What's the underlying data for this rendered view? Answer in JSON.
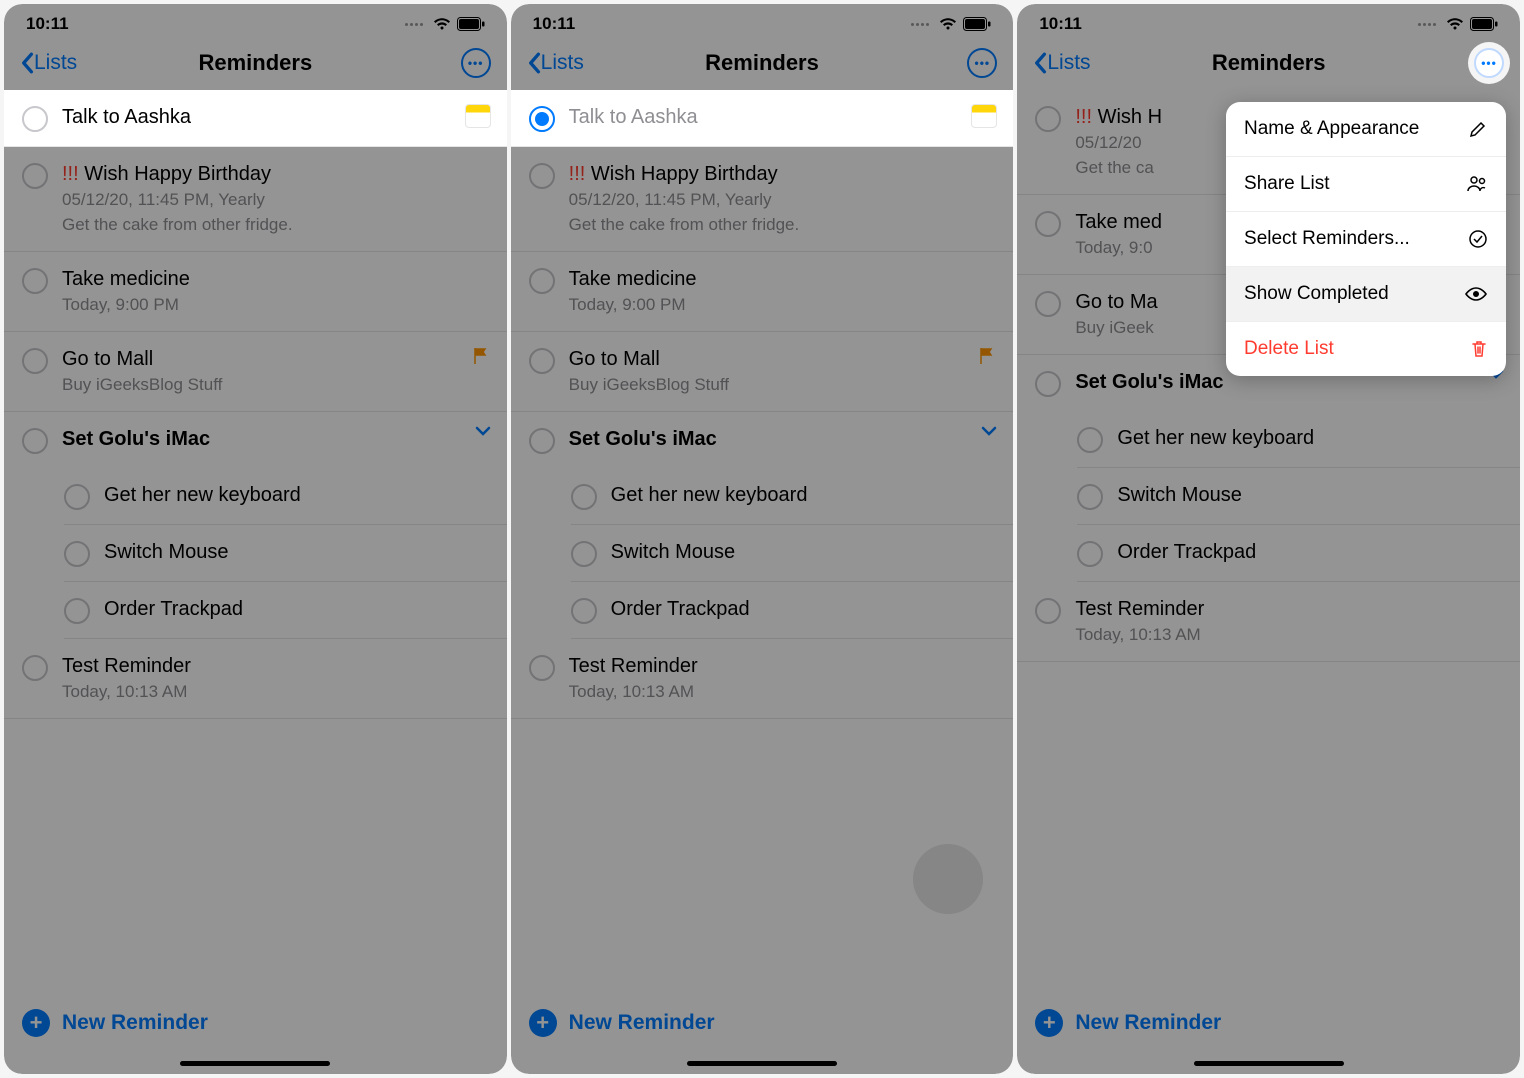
{
  "status": {
    "time": "10:11"
  },
  "nav": {
    "back": "Lists",
    "title": "Reminders"
  },
  "reminders": [
    {
      "title": "Talk to Aashka",
      "hasNote": true
    },
    {
      "title": "Wish Happy Birthday",
      "priority": "!!!",
      "sub1": "05/12/20, 11:45 PM, Yearly",
      "sub2": "Get the cake from other fridge."
    },
    {
      "title": "Take medicine",
      "sub1": "Today, 9:00 PM"
    },
    {
      "title": "Go to Mall",
      "sub1": "Buy iGeeksBlog Stuff",
      "flag": true
    },
    {
      "title": "Set Golu's iMac",
      "expandable": true
    },
    {
      "title": "Get her new keyboard",
      "sub": true
    },
    {
      "title": "Switch Mouse",
      "sub": true
    },
    {
      "title": "Order Trackpad",
      "sub": true
    },
    {
      "title": "Test Reminder",
      "sub1": "Today, 10:13 AM"
    }
  ],
  "screen3_reminders": [
    {
      "title": "Wish H",
      "priority": "!!!",
      "sub1": "05/12/20",
      "sub2": "Get the ca"
    },
    {
      "title": "Take med",
      "sub1": "Today, 9:0"
    },
    {
      "title": "Go to Ma",
      "sub1": "Buy iGeek"
    },
    {
      "title": "Set Golu's iMac",
      "expandable": true
    },
    {
      "title": "Get her new keyboard",
      "sub": true
    },
    {
      "title": "Switch Mouse",
      "sub": true
    },
    {
      "title": "Order Trackpad",
      "sub": true
    },
    {
      "title": "Test Reminder",
      "sub1": "Today, 10:13 AM"
    }
  ],
  "newReminder": "New Reminder",
  "popover": {
    "nameAppearance": "Name & Appearance",
    "shareList": "Share List",
    "selectReminders": "Select Reminders...",
    "showCompleted": "Show Completed",
    "deleteList": "Delete List"
  }
}
